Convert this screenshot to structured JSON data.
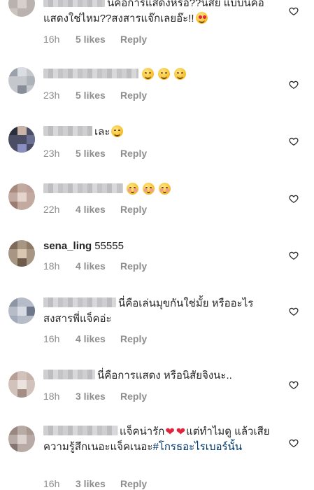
{
  "comments": [
    {
      "username": "",
      "text": "นคือการแสดงหรอ??นสัย แบบนี้คือแสดงใช่ไหม??สงสารแจ๊กเลยอ๊ะ!!",
      "emoji": "heart-eyes",
      "time": "16h",
      "likes": "5 likes",
      "reply": "Reply"
    },
    {
      "username": "",
      "text": "",
      "emoji": "grin x3",
      "time": "23h",
      "likes": "5 likes",
      "reply": "Reply"
    },
    {
      "username": "",
      "text": "เละ",
      "emoji": "grin",
      "time": "23h",
      "likes": "5 likes",
      "reply": "Reply"
    },
    {
      "username": "",
      "text": "",
      "emoji": "blush x3",
      "time": "22h",
      "likes": "4 likes",
      "reply": "Reply"
    },
    {
      "username": "sena_ling",
      "text": "55555",
      "time": "18h",
      "likes": "4 likes",
      "reply": "Reply"
    },
    {
      "username": "",
      "text": "นี่คือเล่นมุขกันใช่มั้ย หรืออะไร สงสารพี่แจ็คอ่ะ",
      "time": "16h",
      "likes": "4 likes",
      "reply": "Reply"
    },
    {
      "username": "",
      "text": "นี่คือการแสดง หรือนิสัยจิงนะ..",
      "time": "18h",
      "likes": "3 likes",
      "reply": "Reply"
    },
    {
      "username": "",
      "text_before": "แจ็คน่ารัก",
      "text_after": "แต่ทำไมดู แล้วเสียความรู้สึกเนอะแจ็คเนอะ",
      "hashtag": "#โกรธอะไรเบอร์นั้น",
      "emoji": "red-heart x2",
      "time": "16h",
      "likes": "3 likes",
      "reply": "Reply"
    }
  ],
  "icons": {
    "like": "heart-outline-icon"
  }
}
